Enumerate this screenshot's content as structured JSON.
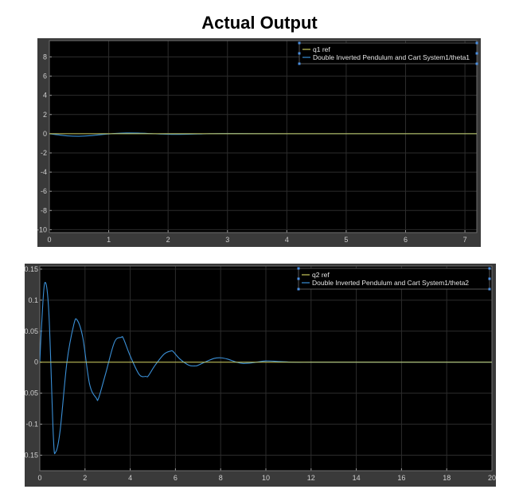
{
  "page_title": "Actual Output",
  "colors": {
    "reference_line": "#c8c85a",
    "signal_line": "#3a8fd6",
    "axes_bg": "#000000",
    "frame": "#3a3a3a",
    "grid": "#2c2c2c",
    "tick_text": "#d0d0d0",
    "legend_border": "#6a6a6a",
    "legend_handle": "#4a8ee0"
  },
  "chart_data": [
    {
      "type": "line",
      "title": "",
      "xlabel": "",
      "ylabel": "",
      "xlim": [
        0,
        7.2
      ],
      "ylim": [
        -10.3,
        9.7
      ],
      "xticks": [
        0,
        1,
        2,
        3,
        4,
        5,
        6,
        7
      ],
      "yticks": [
        -10,
        -8,
        -6,
        -4,
        -2,
        0,
        2,
        4,
        6,
        8
      ],
      "grid": true,
      "legend_position": "top-right",
      "series": [
        {
          "name": "q1 ref",
          "color": "#c8c85a",
          "x": [
            0,
            7.2
          ],
          "y": [
            0,
            0
          ]
        },
        {
          "name": "Double Inverted Pendulum and Cart System1/theta1",
          "color": "#3a8fd6",
          "x": [
            0,
            0.15,
            0.3,
            0.5,
            0.7,
            0.9,
            1.1,
            1.3,
            1.5,
            1.7,
            1.9,
            2.1,
            2.3,
            2.5,
            2.7,
            2.9,
            3.2,
            3.6,
            4.0,
            5.0,
            6.0,
            7.2
          ],
          "y": [
            0,
            -0.12,
            -0.22,
            -0.26,
            -0.2,
            -0.08,
            0.03,
            0.08,
            0.07,
            0.02,
            -0.04,
            -0.07,
            -0.06,
            -0.03,
            0.01,
            0.02,
            0.015,
            0.005,
            0,
            0,
            0,
            0
          ]
        }
      ]
    },
    {
      "type": "line",
      "title": "",
      "xlabel": "",
      "ylabel": "",
      "xlim": [
        0,
        20
      ],
      "ylim": [
        -0.175,
        0.155
      ],
      "xticks": [
        0,
        2,
        4,
        6,
        8,
        10,
        12,
        14,
        16,
        18,
        20
      ],
      "yticks": [
        -0.15,
        -0.1,
        -0.05,
        0,
        0.05,
        0.1,
        0.15
      ],
      "grid": true,
      "legend_position": "top-right",
      "series": [
        {
          "name": "q2 ref",
          "color": "#c8c85a",
          "x": [
            0,
            20
          ],
          "y": [
            0,
            0
          ]
        },
        {
          "name": "Double Inverted Pendulum and Cart System1/theta2",
          "color": "#3a8fd6",
          "x": [
            0,
            0.08,
            0.22,
            0.4,
            0.6,
            0.7,
            0.9,
            1.2,
            1.5,
            1.65,
            1.9,
            2.2,
            2.5,
            2.6,
            2.9,
            3.3,
            3.6,
            3.7,
            4.0,
            4.4,
            4.7,
            4.8,
            5.1,
            5.5,
            5.8,
            5.9,
            6.2,
            6.6,
            6.9,
            7.0,
            7.3,
            7.7,
            8.0,
            8.3,
            8.7,
            9.0,
            9.4,
            10.0,
            10.6,
            11.2,
            12.0,
            13.0,
            15.0,
            20.0
          ],
          "y": [
            0,
            0.06,
            0.128,
            0.08,
            -0.12,
            -0.145,
            -0.11,
            0.0,
            0.06,
            0.068,
            0.04,
            -0.035,
            -0.058,
            -0.058,
            -0.02,
            0.032,
            0.04,
            0.038,
            0.01,
            -0.02,
            -0.023,
            -0.022,
            -0.005,
            0.013,
            0.018,
            0.017,
            0.005,
            -0.005,
            -0.006,
            -0.005,
            0.0,
            0.006,
            0.007,
            0.005,
            0.0,
            -0.002,
            -0.001,
            0.002,
            0.001,
            0.0,
            0.0,
            0.0,
            0.0,
            0.0
          ]
        }
      ]
    }
  ]
}
